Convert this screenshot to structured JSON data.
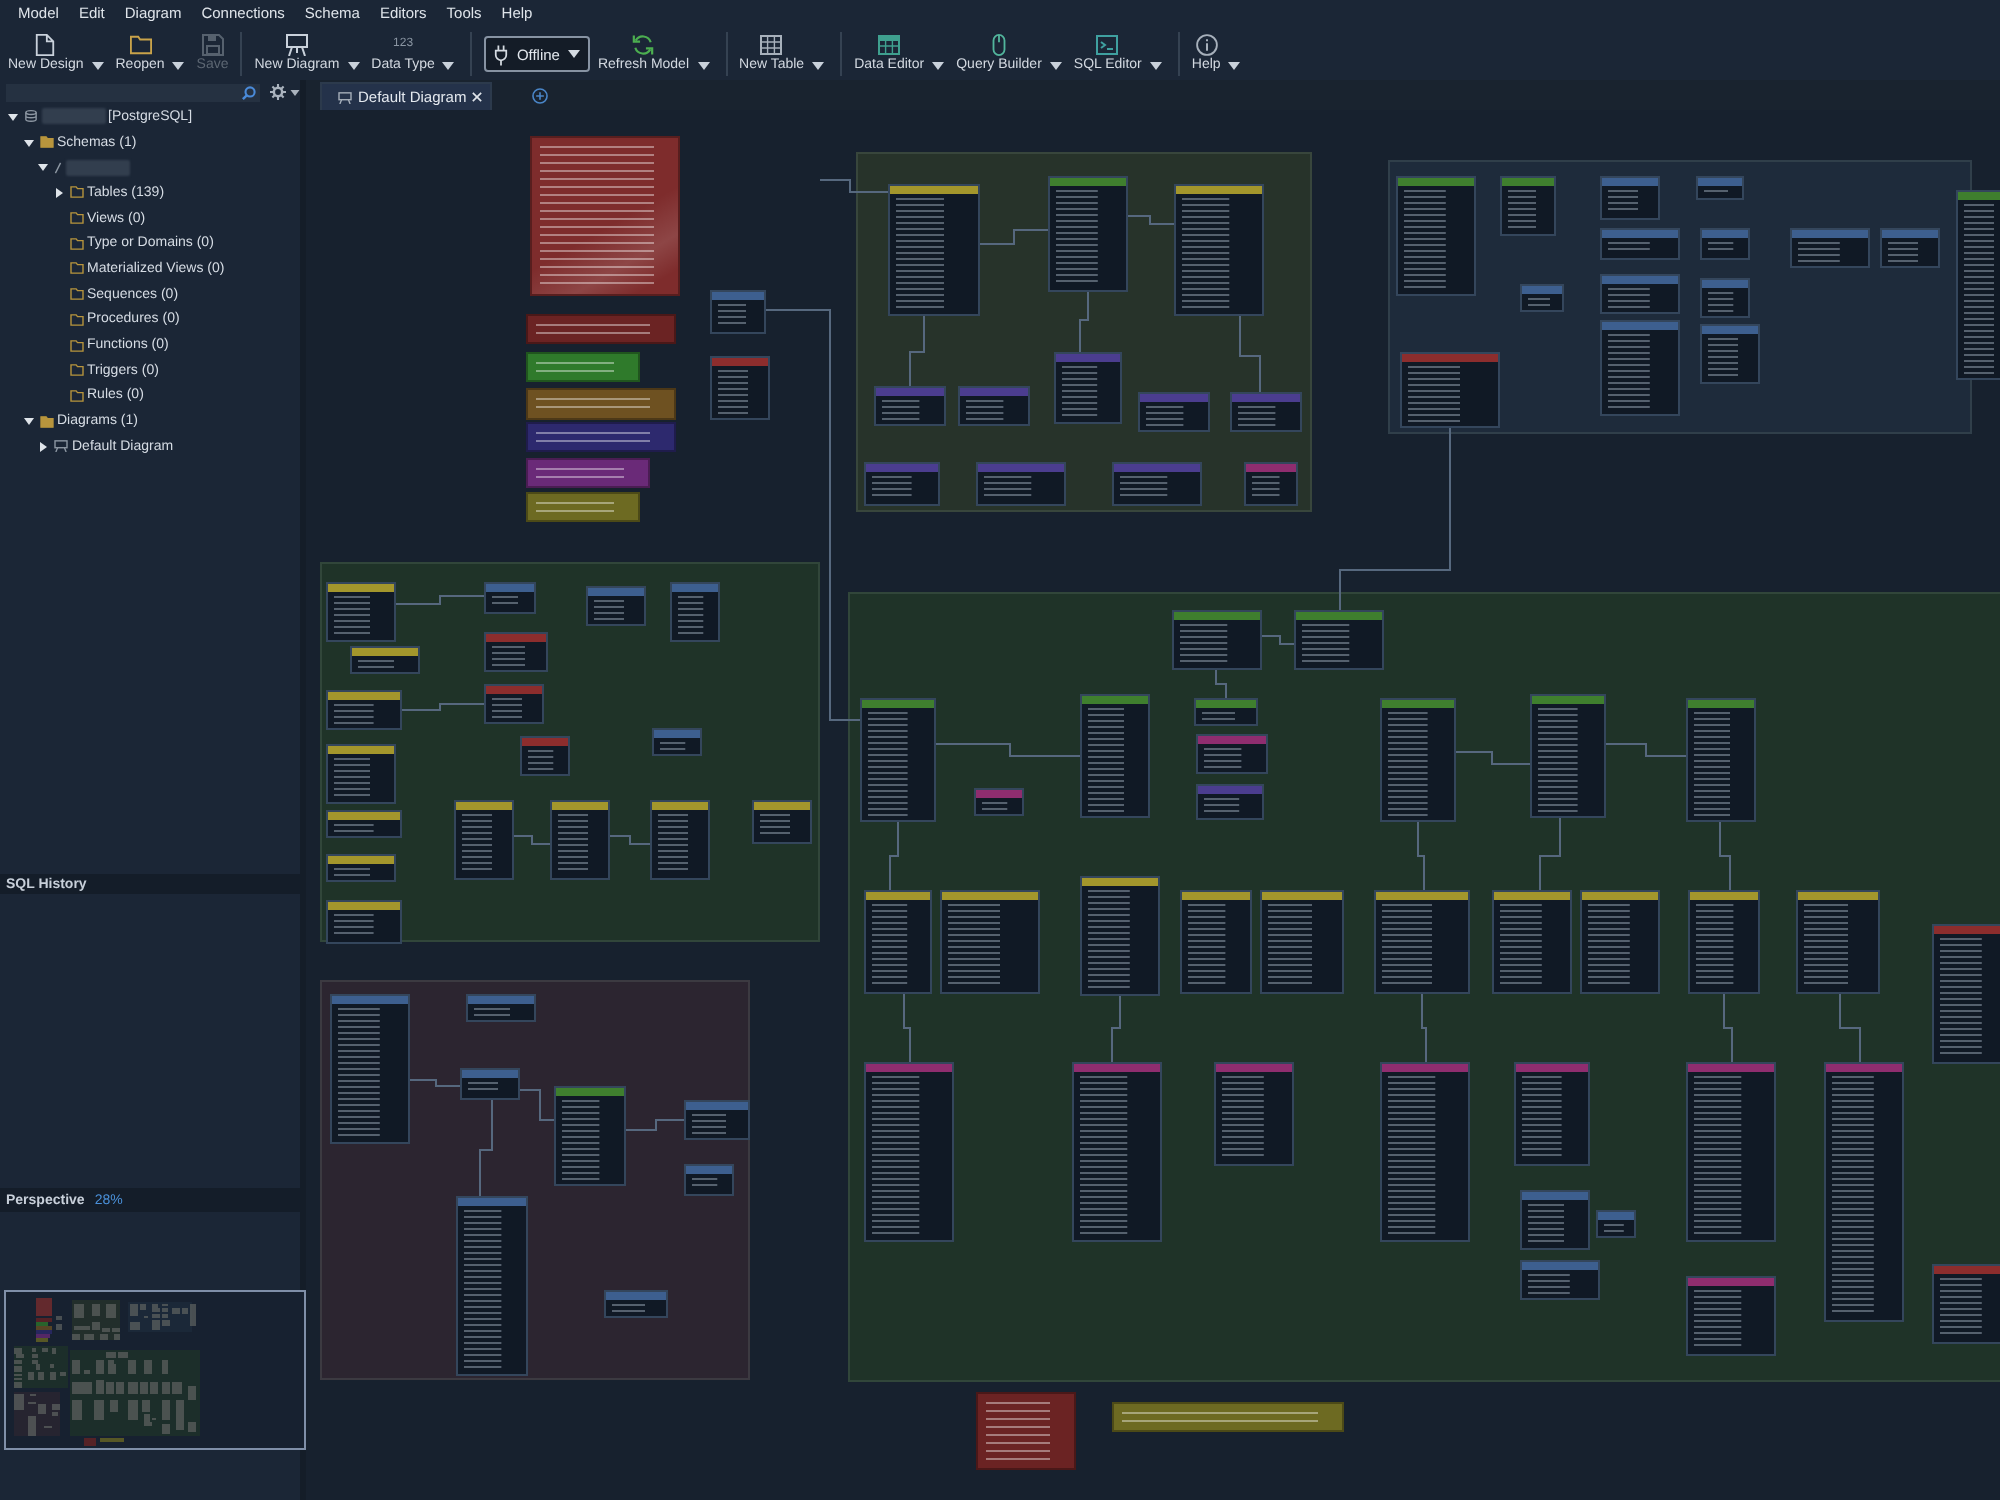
{
  "menu": [
    "Model",
    "Edit",
    "Diagram",
    "Connections",
    "Schema",
    "Editors",
    "Tools",
    "Help"
  ],
  "toolbar": {
    "groups": [
      {
        "tools": [
          {
            "kind": "button",
            "label": "New Design",
            "dropdown": true,
            "disabled": false
          },
          {
            "kind": "button",
            "label": "Reopen",
            "dropdown": true,
            "disabled": false
          },
          {
            "kind": "button",
            "label": "Save",
            "dropdown": false,
            "disabled": true
          }
        ]
      },
      {
        "tools": [
          {
            "kind": "button",
            "label": "New Diagram",
            "dropdown": true,
            "disabled": false
          },
          {
            "kind": "button",
            "label": "Data Type",
            "icon_text": "123",
            "dropdown": true,
            "disabled": false
          }
        ]
      },
      {
        "tools": [
          {
            "kind": "selector",
            "label": "Offline",
            "dropdown": true,
            "disabled": false
          },
          {
            "kind": "button",
            "label": "Refresh Model",
            "dropdown": true,
            "disabled": false
          }
        ]
      },
      {
        "tools": [
          {
            "kind": "button",
            "label": "New Table",
            "dropdown": true,
            "disabled": false
          }
        ]
      },
      {
        "tools": [
          {
            "kind": "button",
            "label": "Data Editor",
            "dropdown": true,
            "disabled": false
          },
          {
            "kind": "button",
            "label": "Query Builder",
            "dropdown": true,
            "disabled": false
          },
          {
            "kind": "button",
            "label": "SQL Editor",
            "dropdown": true,
            "disabled": false
          }
        ]
      },
      {
        "tools": [
          {
            "kind": "button",
            "label": "Help",
            "dropdown": true,
            "disabled": false
          }
        ]
      }
    ]
  },
  "sidebar": {
    "tree": [
      {
        "label": "[PostgreSQL]",
        "kind": "database",
        "redacted": true,
        "expanded": true,
        "children": [
          {
            "label": "Schemas (1)",
            "kind": "folder",
            "expanded": true,
            "children": [
              {
                "kind": "schema",
                "redacted": true,
                "expanded": true,
                "children": [
                  {
                    "label": "Tables (139)",
                    "kind": "folder",
                    "expanded": false
                  },
                  {
                    "label": "Views (0)",
                    "kind": "folder"
                  },
                  {
                    "label": "Type or Domains (0)",
                    "kind": "folder"
                  },
                  {
                    "label": "Materialized Views (0)",
                    "kind": "folder"
                  },
                  {
                    "label": "Sequences (0)",
                    "kind": "folder"
                  },
                  {
                    "label": "Procedures (0)",
                    "kind": "folder"
                  },
                  {
                    "label": "Functions (0)",
                    "kind": "folder"
                  },
                  {
                    "label": "Triggers (0)",
                    "kind": "folder"
                  },
                  {
                    "label": "Rules (0)",
                    "kind": "folder"
                  }
                ]
              }
            ]
          },
          {
            "label": "Diagrams (1)",
            "kind": "folder",
            "expanded": true,
            "children": [
              {
                "label": "Default Diagram",
                "kind": "diagram",
                "expanded": false
              }
            ]
          }
        ]
      }
    ]
  },
  "sql_history": {
    "title": "SQL History"
  },
  "perspective": {
    "title": "Perspective",
    "zoom": "28%"
  },
  "tabs": [
    {
      "label": "Default Diagram",
      "selected": true
    }
  ],
  "diagram": {
    "groups": [
      {
        "color": "#27332a"
      },
      {
        "color": "#1e2b3b"
      },
      {
        "color": "#1f3328"
      },
      {
        "color": "#1f3328"
      },
      {
        "color": "#2c2530"
      }
    ],
    "notes": [
      {
        "color": "#7e2c2c"
      },
      {
        "color": "#6b2323"
      },
      {
        "color": "#2f7a2b"
      },
      {
        "color": "#6e5121"
      },
      {
        "color": "#2d296e"
      },
      {
        "color": "#6a2a78"
      },
      {
        "color": "#6d6a22"
      },
      {
        "color": "#6b2323"
      },
      {
        "color": "#6d6a22"
      }
    ],
    "tables": [
      {
        "color": "#a3962c"
      },
      {
        "color": "#3f7f2e"
      },
      {
        "color": "#a3962c"
      },
      {
        "color": "#4b3d8f"
      },
      {
        "color": "#4b3d8f"
      },
      {
        "color": "#4b3d8f"
      },
      {
        "color": "#4b3d8f"
      },
      {
        "color": "#4b3d8f"
      },
      {
        "color": "#4b3d8f"
      },
      {
        "color": "#4b3d8f"
      },
      {
        "color": "#4b3d8f"
      },
      {
        "color": "#8f2d6f"
      },
      {
        "color": "#3d5f8f"
      },
      {
        "color": "#8c2d2d"
      },
      {
        "color": "#3f7f2e"
      },
      {
        "color": "#3f7f2e"
      },
      {
        "color": "#3d5f8f"
      },
      {
        "color": "#3d5f8f"
      },
      {
        "color": "#3d5f8f"
      },
      {
        "color": "#3d5f8f"
      },
      {
        "color": "#3d5f8f"
      },
      {
        "color": "#3d5f8f"
      },
      {
        "color": "#3d5f8f"
      },
      {
        "color": "#3d5f8f"
      },
      {
        "color": "#3d5f8f"
      },
      {
        "color": "#3d5f8f"
      },
      {
        "color": "#3d5f8f"
      },
      {
        "color": "#8c2d2d"
      },
      {
        "color": "#3f7f2e"
      },
      {
        "color": "#a3962c"
      },
      {
        "color": "#3d5f8f"
      },
      {
        "color": "#3d5f8f"
      },
      {
        "color": "#3d5f8f"
      },
      {
        "color": "#a3962c"
      },
      {
        "color": "#a3962c"
      },
      {
        "color": "#8c2d2d"
      },
      {
        "color": "#8c2d2d"
      },
      {
        "color": "#8c2d2d"
      },
      {
        "color": "#3d5f8f"
      },
      {
        "color": "#a3962c"
      },
      {
        "color": "#a3962c"
      },
      {
        "color": "#a3962c"
      },
      {
        "color": "#a3962c"
      },
      {
        "color": "#a3962c"
      },
      {
        "color": "#a3962c"
      },
      {
        "color": "#a3962c"
      },
      {
        "color": "#a3962c"
      },
      {
        "color": "#3f7f2e"
      },
      {
        "color": "#3f7f2e"
      },
      {
        "color": "#3f7f2e"
      },
      {
        "color": "#3f7f2e"
      },
      {
        "color": "#3f7f2e"
      },
      {
        "color": "#8f2d6f"
      },
      {
        "color": "#4b3d8f"
      },
      {
        "color": "#8f2d6f"
      },
      {
        "color": "#3f7f2e"
      },
      {
        "color": "#3f7f2e"
      },
      {
        "color": "#3f7f2e"
      },
      {
        "color": "#a3962c"
      },
      {
        "color": "#a3962c"
      },
      {
        "color": "#a3962c"
      },
      {
        "color": "#a3962c"
      },
      {
        "color": "#a3962c"
      },
      {
        "color": "#a3962c"
      },
      {
        "color": "#a3962c"
      },
      {
        "color": "#a3962c"
      },
      {
        "color": "#a3962c"
      },
      {
        "color": "#a3962c"
      },
      {
        "color": "#8c2d2d"
      },
      {
        "color": "#8f2d6f"
      },
      {
        "color": "#8f2d6f"
      },
      {
        "color": "#8f2d6f"
      },
      {
        "color": "#8f2d6f"
      },
      {
        "color": "#8f2d6f"
      },
      {
        "color": "#8f2d6f"
      },
      {
        "color": "#8f2d6f"
      },
      {
        "color": "#3d5f8f"
      },
      {
        "color": "#3d5f8f"
      },
      {
        "color": "#3d5f8f"
      },
      {
        "color": "#8f2d6f"
      },
      {
        "color": "#8c2d2d"
      },
      {
        "color": "#3d5f8f"
      },
      {
        "color": "#3d5f8f"
      },
      {
        "color": "#3d5f8f"
      },
      {
        "color": "#3f7f2e"
      },
      {
        "color": "#3d5f8f"
      },
      {
        "color": "#3d5f8f"
      },
      {
        "color": "#3d5f8f"
      },
      {
        "color": "#3d5f8f"
      }
    ]
  }
}
